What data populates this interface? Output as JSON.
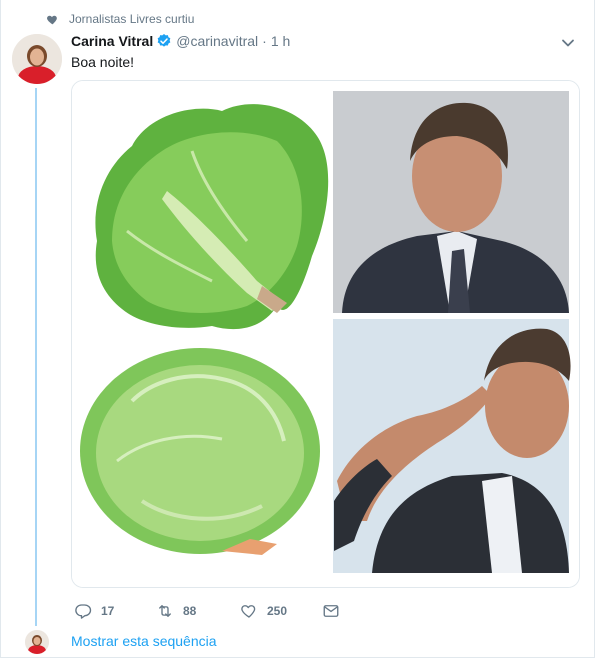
{
  "social_context": {
    "text": "Jornalistas Livres curtiu",
    "icon": "heart-icon"
  },
  "tweet": {
    "author_name": "Carina Vitral",
    "verified": true,
    "handle": "@carinavitral",
    "separator": "·",
    "time": "1 h",
    "text": "Boa noite!",
    "media_description_items": [
      "lettuce-image",
      "man-in-suit-image",
      "iceberg-lettuce-image",
      "saluting-man-image"
    ]
  },
  "actions": {
    "replies": "17",
    "retweets": "88",
    "likes": "250"
  },
  "thread": {
    "show_thread_label": "Mostrar esta sequência"
  },
  "colors": {
    "accent": "#1da1f2",
    "muted": "#657786",
    "thread_line": "#a6d5f5",
    "border": "#e1e8ed"
  }
}
